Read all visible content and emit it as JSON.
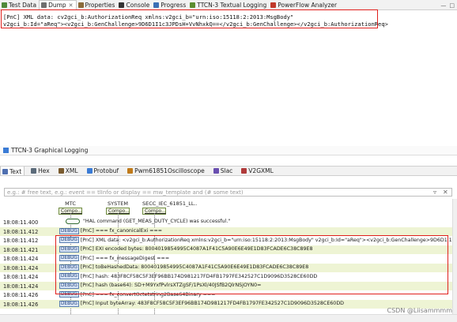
{
  "top_tabs": [
    {
      "label": "Test Data",
      "color": "#4f8a3a"
    },
    {
      "label": "Dump",
      "color": "#6f6f6f",
      "active": true
    },
    {
      "label": "Properties",
      "color": "#8b6b3a"
    },
    {
      "label": "Console",
      "color": "#333333"
    },
    {
      "label": "Progress",
      "color": "#3a6fb5"
    },
    {
      "label": "TTCN-3 Textual Logging",
      "color": "#5b8d2f"
    },
    {
      "label": "PowerFlow Analyzer",
      "color": "#c0392b"
    }
  ],
  "dump": {
    "line1": "[PnC] XML data: cv2gci_b:AuthorizationReq xmlns:v2gci_b=\"urn:iso:15118:2:2013:MsgBody\"",
    "line2": "v2gci_b:Id=\"aReq\"><v2gci_b:GenChallenge>9D6D1I1c3JPDsH+VvNhxkQ==</v2gci_b:GenChallenge></v2gci_b:AuthorizationReq>"
  },
  "panel_title": "TTCN-3 Graphical Logging",
  "sub_tabs": [
    "Text",
    "Hex",
    "XML",
    "Protobuf",
    "Pwm61851Oscilloscope",
    "Slac",
    "V2GXML"
  ],
  "filter_placeholder": "e.g.: # free text, e.g.: event == tlInfo or display == mw_template and (# some text)",
  "components": {
    "mtc": {
      "name": "MTC",
      "box": "Compo..."
    },
    "system": {
      "name": "SYSTEM",
      "box": "Compo..."
    },
    "secc": {
      "name": "SECC_IEC_61851_LL..",
      "box": "Compo..."
    }
  },
  "log_rows": [
    {
      "ts": "18:08:11.400",
      "text": "\"HAL command (GET_MEAS_DUTY_CYCLE) was successful.\"",
      "debug": false,
      "oval": true
    },
    {
      "ts": "18:08:11.412",
      "text": "[PnC] === fx_canonicalExi ===",
      "debug": true
    },
    {
      "ts": "18:08:11.412",
      "text": "[PnC] XML data: <v2gci_b:AuthorizationReq xmlns:v2gci_b=\"urn:iso:15118:2:2013:MsgBody\" v2gci_b:Id=\"aReq\"><v2gci_b:GenChallenge>9D6D1I1c3JPDsH+Vv..",
      "debug": true
    },
    {
      "ts": "18:08:11.421",
      "text": "[PnC] EXI encoded bytes: 8004019854995C4087A1F41C5A90E6E49E1D83FCADE6C38C89E8",
      "debug": true
    },
    {
      "ts": "18:08:11.424",
      "text": "[PnC] === fx_messageDigest ===",
      "debug": true
    },
    {
      "ts": "18:08:11.424",
      "text": "[PnC] toBeHashedData: 8004019854995C4087A1F41C5A90E6E49E1D83FCADE6C38C89E8",
      "debug": true
    },
    {
      "ts": "18:08:11.424",
      "text": "[PnC] hash: 483F8CF58C5F3EF96BB174D981217FD4FB1797FE342527C1D9096D3528CE60DD",
      "debug": true
    },
    {
      "ts": "18:08:11.424",
      "text": "[PnC] hash (base64): SD+M9YxfPvlrsXTZgSF/1PsXl/40JSfB2QlrNSjOYN0=",
      "debug": true
    },
    {
      "ts": "18:08:11.426",
      "text": "[PnC] === fx_convertOctetstring2Base64Binary ===",
      "debug": true
    },
    {
      "ts": "18:08:11.426",
      "text": "[PnC] Input byteArray: 483F8CF58C5F3EF96BB174D981217FD4FB1797FE342527C1D9096D3528CE60DD",
      "debug": true
    }
  ],
  "debug_label": "DEBUG",
  "watermark": "CSDN @Liisammmm"
}
